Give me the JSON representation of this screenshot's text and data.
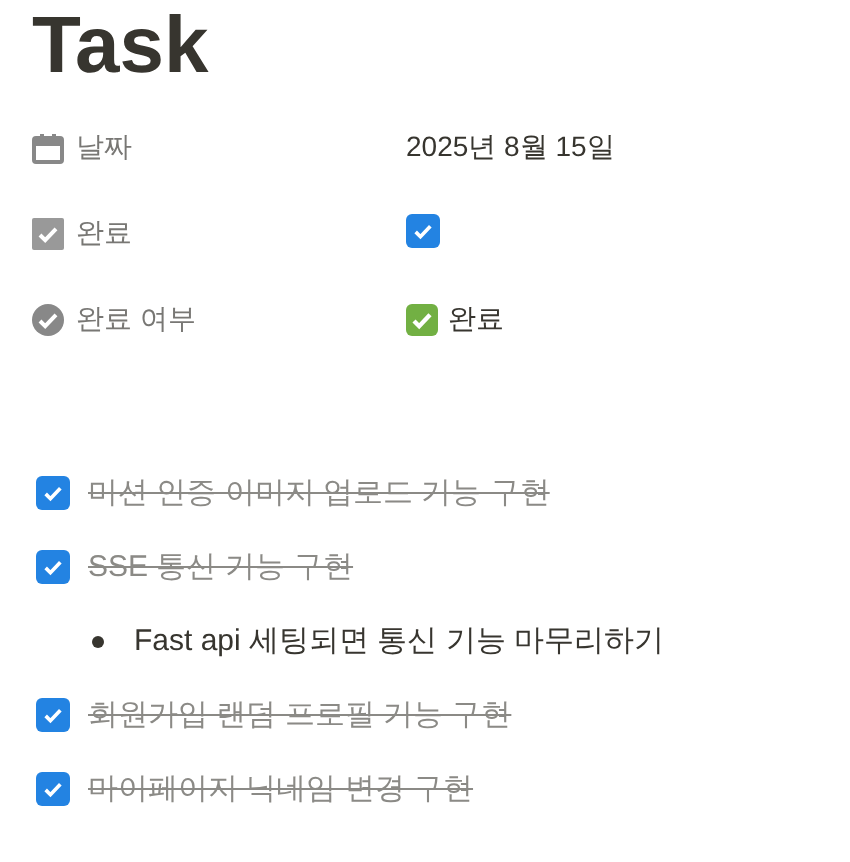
{
  "title": "Task",
  "properties": [
    {
      "kind": "date",
      "label": "날짜",
      "value": "2025년 8월 15일"
    },
    {
      "kind": "checkbox",
      "label": "완료",
      "checked": true
    },
    {
      "kind": "status",
      "label": "완료 여부",
      "value": "완료"
    }
  ],
  "todos": [
    {
      "kind": "todo",
      "text": "미션 인증 이미지 업로드 기능 구현",
      "checked": true
    },
    {
      "kind": "todo",
      "text": "SSE 통신 기능 구현",
      "checked": true
    },
    {
      "kind": "bullet",
      "text": "Fast api 세팅되면 통신 기능 마무리하기"
    },
    {
      "kind": "todo",
      "text": "회원가입 랜덤 프로필 기능 구현",
      "checked": true
    },
    {
      "kind": "todo",
      "text": "마이페이지 닉네임 변경 구현",
      "checked": true
    }
  ]
}
